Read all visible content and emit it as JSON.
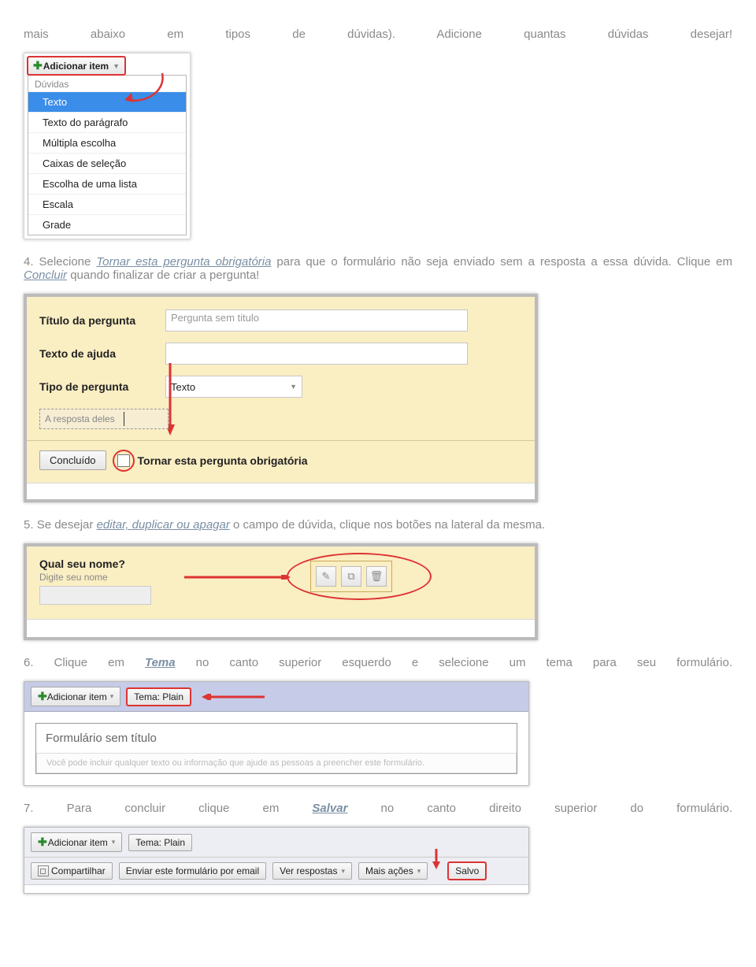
{
  "intro_line": "mais abaixo em tipos de dúvidas). Adicione quantas dúvidas desejar!",
  "dropdown_figure": {
    "button_label": "Adicionar item",
    "header": "Dúvidas",
    "items": [
      "Texto",
      "Texto do parágrafo",
      "Múltipla escolha",
      "Caixas de seleção",
      "Escolha de uma lista",
      "Escala",
      "Grade"
    ],
    "selected": "Texto"
  },
  "step4": {
    "num": "4.",
    "pre": "Selecione ",
    "link1": "Tornar esta pergunta obrigatória",
    "mid": " para que o formulário não seja enviado sem a resposta a essa dúvida. Clique em ",
    "link2": "Concluir",
    "post": " quando finalizar de criar a pergunta!"
  },
  "editor_figure": {
    "label_title": "Título da pergunta",
    "title_placeholder": "Pergunta sem titulo",
    "label_help": "Texto de ajuda",
    "label_type": "Tipo de pergunta",
    "type_selected": "Texto",
    "answer_placeholder": "A resposta deles",
    "done_button": "Concluído",
    "mandatory_label": "Tornar esta pergunta obrigatória"
  },
  "step5": {
    "num": "5.",
    "pre": "Se desejar ",
    "link": "editar, duplicar ou apagar",
    "post": " o campo de dúvida, clique nos botões na lateral da mesma."
  },
  "edit_figure": {
    "question_title": "Qual seu nome?",
    "question_hint": "Digite seu nome",
    "tool_edit": "pencil-icon",
    "tool_duplicate": "duplicate-icon",
    "tool_delete": "trash-icon"
  },
  "step6": {
    "num": "6.",
    "pre": "Clique em ",
    "link": "Tema",
    "post": " no canto superior esquerdo e selecione um tema para seu formulário."
  },
  "theme_figure": {
    "add_item": "Adicionar item",
    "theme_btn": "Tema: Plain",
    "form_title": "Formulário sem título",
    "form_desc": "Você pode incluir qualquer texto ou informação que ajude as pessoas a preencher este formulário."
  },
  "step7": {
    "num": "7.",
    "pre": "Para concluir clique em ",
    "link": "Salvar",
    "post": " no canto direito superior do formulário."
  },
  "save_figure": {
    "add_item": "Adicionar item",
    "theme_btn": "Tema: Plain",
    "share": "Compartilhar",
    "email": "Enviar este formulário por email",
    "responses": "Ver respostas",
    "more": "Mais ações",
    "saved": "Salvo"
  }
}
